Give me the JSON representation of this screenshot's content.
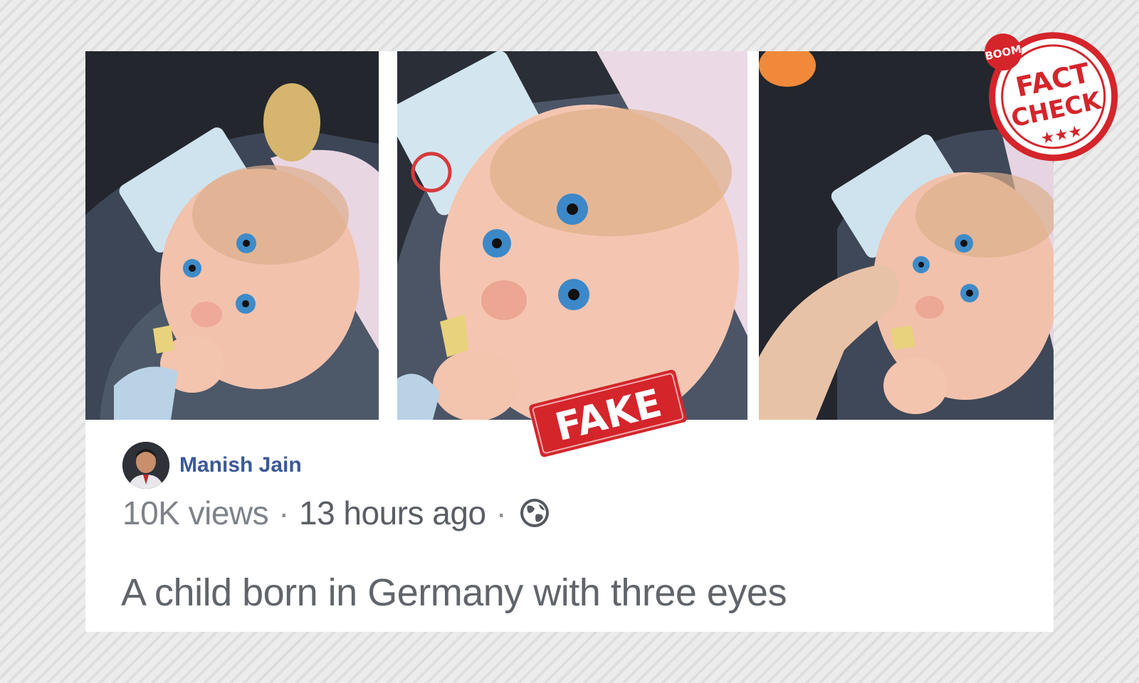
{
  "post": {
    "author": "Manish Jain",
    "views": "10K views",
    "time": "13 hours ago",
    "privacy_icon": "globe-icon",
    "caption": "A child born in Germany with three eyes"
  },
  "stamps": {
    "fake": "FAKE",
    "fact_check_top": "BOOM",
    "fact_check_line1": "FACT",
    "fact_check_line2": "CHECK",
    "fact_check_stars": "★★★"
  },
  "colors": {
    "author_link": "#3b5998",
    "stamp_red": "#d4252b",
    "meta_text": "#7e8289",
    "caption_text": "#61656b"
  }
}
